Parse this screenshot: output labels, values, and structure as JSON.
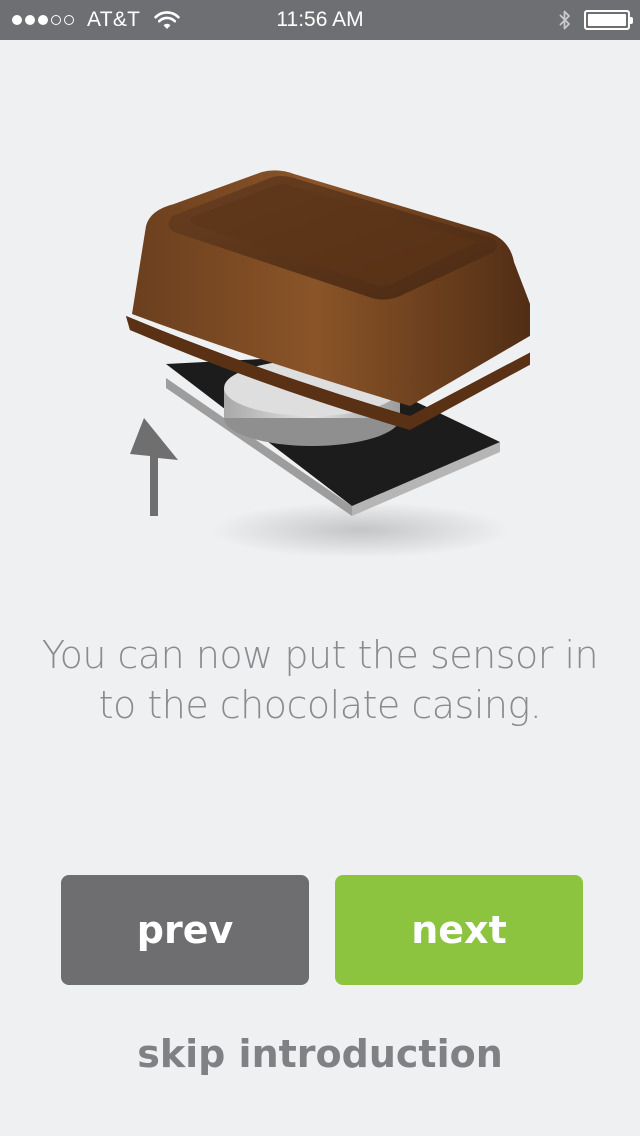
{
  "status_bar": {
    "carrier": "AT&T",
    "time": "11:56 AM",
    "signal_strength": 3,
    "signal_max": 5,
    "battery_level": 1.0,
    "icons": [
      "signal-dots-icon",
      "wifi-icon",
      "bluetooth-icon",
      "battery-icon"
    ]
  },
  "illustration": {
    "icon": "sensor-casing-illustration",
    "colors": {
      "chocolate": "#6b3f1f",
      "chocolate_light": "#8a5428",
      "sensor_board": "#1c1c1c",
      "sensor_disc": "#c9c9c9",
      "arrow": "#6f6f6f"
    }
  },
  "content": {
    "message_line1": "You can now put the sensor in",
    "message_line2": "to the chocolate casing."
  },
  "buttons": {
    "prev_label": "prev",
    "next_label": "next",
    "prev_color": "#6e6e70",
    "next_color": "#8cc43f"
  },
  "skip": {
    "label": "skip introduction"
  }
}
